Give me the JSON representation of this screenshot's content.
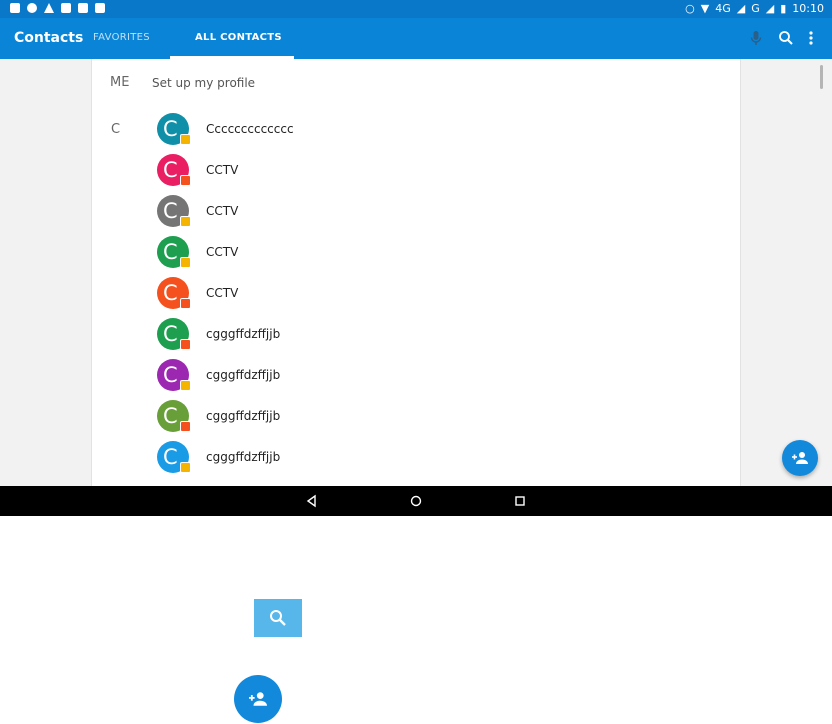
{
  "status_bar": {
    "network_label": "4G",
    "signal_label": "G",
    "time": "10:10"
  },
  "app_bar": {
    "title": "Contacts",
    "tabs": [
      {
        "label": "FAVORITES",
        "selected": false
      },
      {
        "label": "ALL CONTACTS",
        "selected": true
      }
    ],
    "icons": [
      "mic-icon",
      "search-icon",
      "more-vert-icon"
    ]
  },
  "profile": {
    "label": "ME",
    "text": "Set up my profile"
  },
  "section": {
    "letter": "C"
  },
  "contacts": [
    {
      "initial": "C",
      "name": "Ccccccccccccc",
      "color": "#0f8fa8",
      "badge": "#f4b400"
    },
    {
      "initial": "C",
      "name": "CCTV",
      "color": "#e91e63",
      "badge": "#f4511e"
    },
    {
      "initial": "C",
      "name": "CCTV",
      "color": "#757575",
      "badge": "#f4b400"
    },
    {
      "initial": "C",
      "name": "CCTV",
      "color": "#1e9e4f",
      "badge": "#f4b400"
    },
    {
      "initial": "C",
      "name": "CCTV",
      "color": "#f4511e",
      "badge": "#f4511e"
    },
    {
      "initial": "C",
      "name": "cgggffdzffjjb",
      "color": "#1e9e4f",
      "badge": "#f4511e"
    },
    {
      "initial": "C",
      "name": "cgggffdzffjjb",
      "color": "#9c27b0",
      "badge": "#f4b400"
    },
    {
      "initial": "C",
      "name": "cgggffdzffjjb",
      "color": "#689f38",
      "badge": "#f4511e"
    },
    {
      "initial": "C",
      "name": "cgggffdzffjjb",
      "color": "#1a9be6",
      "badge": "#f4b400"
    }
  ],
  "colors": {
    "app_bar": "#0a84d6",
    "status_bar": "#0a78c8",
    "fab": "#1289db"
  }
}
